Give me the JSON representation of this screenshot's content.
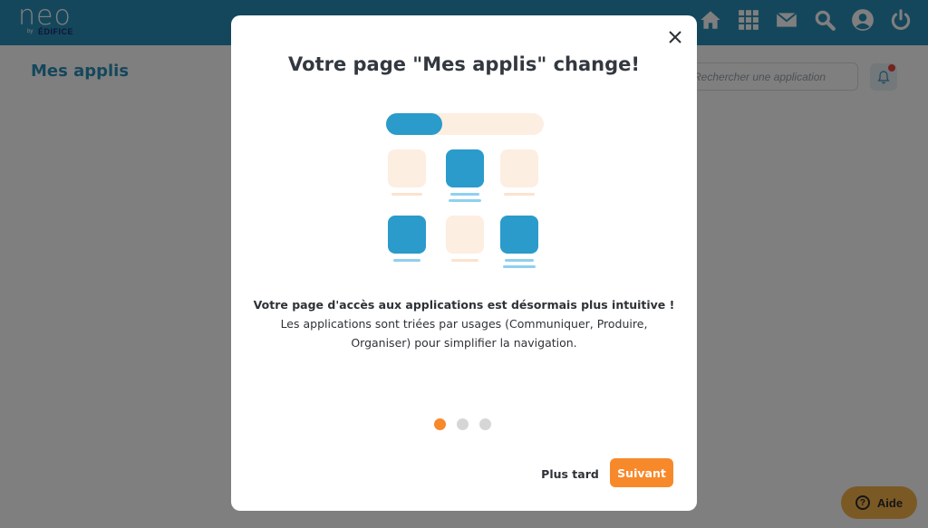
{
  "topbar": {
    "logo_text": "neo",
    "logo_by": "by",
    "logo_brand": "ÉDIFICE",
    "icons": [
      "home-icon",
      "apps-grid-icon",
      "mail-icon",
      "search-icon",
      "account-icon",
      "power-icon"
    ],
    "color": "#2b8fb8"
  },
  "page": {
    "title": "Mes applis",
    "search_placeholder": "Rechercher une application"
  },
  "modal": {
    "title": "Votre page \"Mes applis\" change!",
    "heading": "Votre page d'accès aux applications est désormais plus intuitive !",
    "body": "Les applications sont triées par usages (Communiquer, Produire, Organiser) pour simplifier la navigation.",
    "steps_total": 3,
    "step_active": 1,
    "later_label": "Plus tard",
    "next_label": "Suivant",
    "accent_color": "#f7892b",
    "illustration_color": "#2a9bcb"
  },
  "help": {
    "label": "Aide",
    "color": "#f6b34a"
  }
}
